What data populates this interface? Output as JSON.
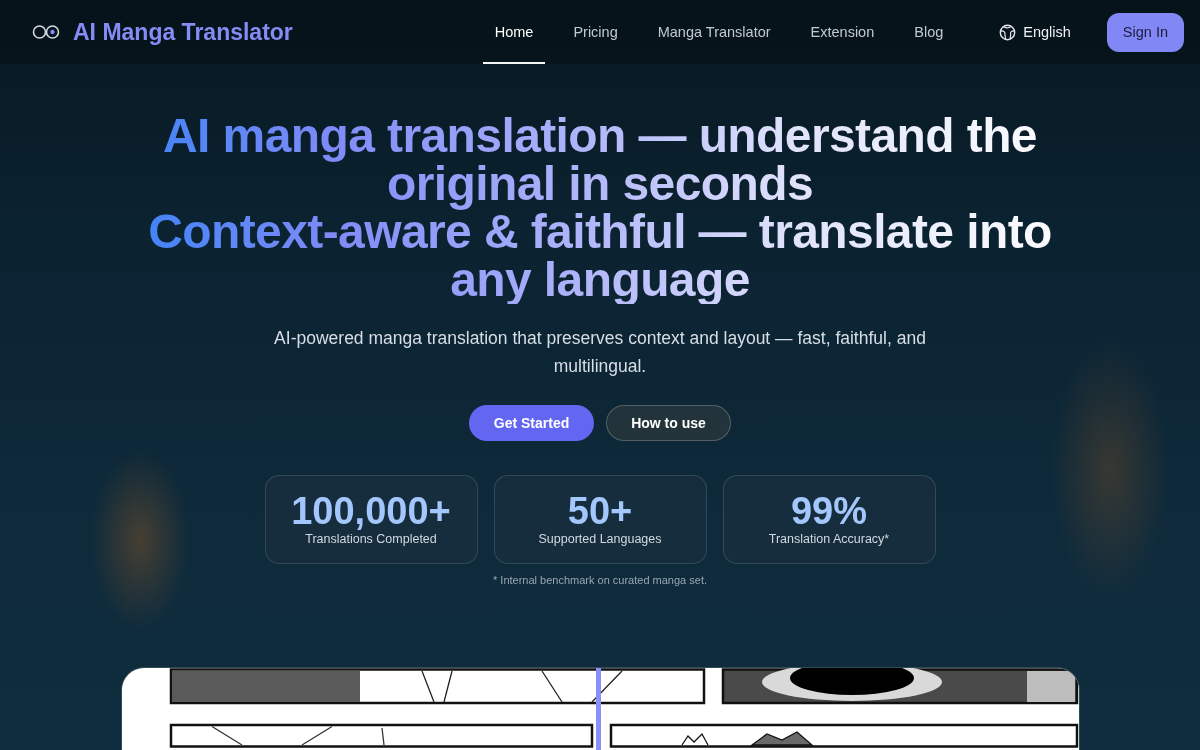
{
  "nav": {
    "brand": "AI Manga Translator",
    "links": [
      {
        "label": "Home",
        "selected": true
      },
      {
        "label": "Pricing",
        "selected": false
      },
      {
        "label": "Manga Translator",
        "selected": false
      },
      {
        "label": "Extension",
        "selected": false
      },
      {
        "label": "Blog",
        "selected": false
      }
    ],
    "language": "English",
    "sign_in": "Sign In"
  },
  "hero": {
    "headline": [
      "AI manga translation — understand the original in seconds",
      "Context-aware & faithful — translate into any language"
    ],
    "subtitle": "AI-powered manga translation that preserves context and layout — fast, faithful, and multilingual.",
    "buttons": [
      {
        "label": "Get Started",
        "kind": "primary"
      },
      {
        "label": "How to use",
        "kind": "secondary"
      }
    ],
    "stats": [
      {
        "value": "100,000+",
        "label": "Translations Completed"
      },
      {
        "value": "50+",
        "label": "Supported Languages"
      },
      {
        "value": "99%",
        "label": "Translation Accuracy*"
      }
    ],
    "footnote": "* Internal benchmark on curated manga set."
  },
  "preview": {
    "level": 0.498
  }
}
